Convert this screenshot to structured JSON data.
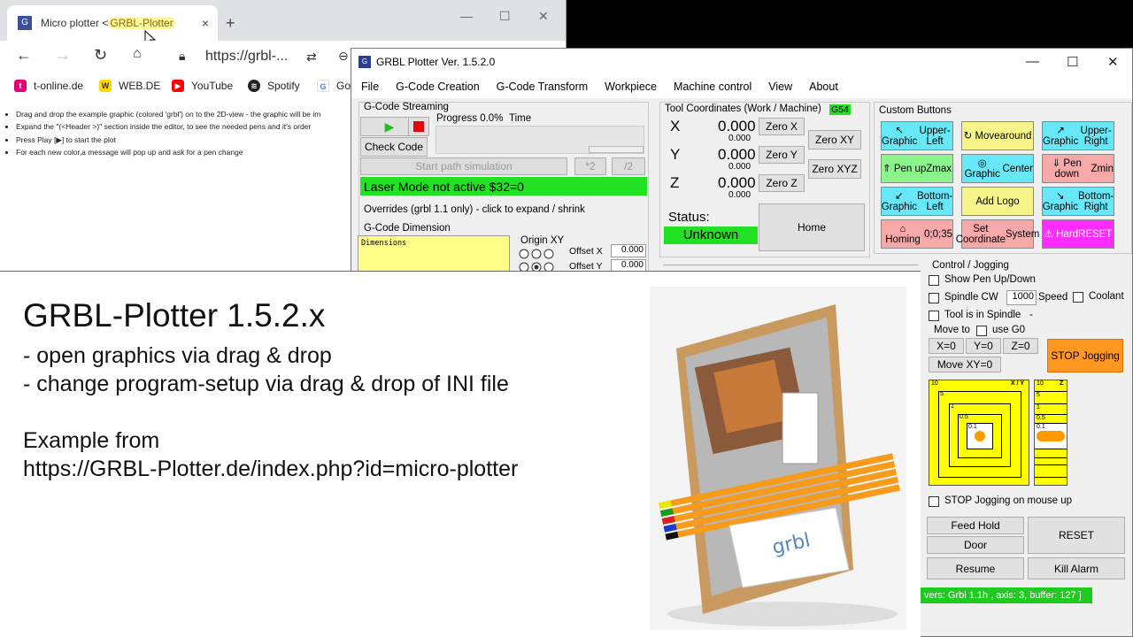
{
  "browser": {
    "tab_title_a": "Micro plotter < ",
    "tab_title_b": "GRBL-Plotter",
    "tab_close": "×",
    "new_tab": "+",
    "win_min": "—",
    "win_max": "☐",
    "win_close": "✕",
    "url": "https://grbl-...",
    "bookmarks": [
      "t-online.de",
      "WEB.DE",
      "YouTube",
      "Spotify",
      "Go"
    ],
    "page_lines": [
      "Drag and drop the example graphic (colored 'grbl') on to the 2D-view - the graphic will be im",
      "Expand the \"(<Header >)\" section inside the editor, to see the needed pens and it's order",
      "Press Play [▶] to start the plot",
      "For each new color,a message will pop up and ask for a pen change"
    ]
  },
  "grbl": {
    "title": "GRBL Plotter Ver. 1.5.2.0",
    "menu": [
      "File",
      "G-Code Creation",
      "G-Code Transform",
      "Workpiece",
      "Machine control",
      "View",
      "About"
    ],
    "streaming": {
      "label": "G-Code Streaming",
      "progress": "Progress 0.0%",
      "time": "Time",
      "check_code": "Check Code",
      "sim": "Start path simulation",
      "x2": "*2",
      "d2": "/2",
      "laser": "Laser Mode not active $32=0",
      "overrides": "Overrides (grbl 1.1 only) - click to expand / shrink",
      "dimension": "G-Code Dimension",
      "dimensions_box": "Dimensions",
      "origin": "Origin XY",
      "offset_x_label": "Offset X",
      "offset_y_label": "Offset Y",
      "offset_x": "0.000",
      "offset_y": "0.000"
    },
    "coords": {
      "label": "Tool Coordinates (Work / Machine)",
      "g54": "G54",
      "x": "X",
      "y": "Y",
      "z": "Z",
      "xw": "0.000",
      "xm": "0.000",
      "yw": "0.000",
      "ym": "0.000",
      "zw": "0.000",
      "zm": "0.000",
      "zero_x": "Zero X",
      "zero_y": "Zero Y",
      "zero_z": "Zero Z",
      "zero_xy": "Zero XY",
      "zero_xyz": "Zero XYZ",
      "status_label": "Status:",
      "status": "Unknown",
      "home": "Home"
    },
    "custom": {
      "label": "Custom Buttons",
      "buttons": [
        {
          "l1": "↖ Graphic",
          "l2": "Upper-Left",
          "color": "#66e8f8"
        },
        {
          "l1": "↻ Move",
          "l2": "around",
          "color": "#f7f58a"
        },
        {
          "l1": "↗ Graphic",
          "l2": "Upper-Right",
          "color": "#66e8f8"
        },
        {
          "l1": "⇑ Pen up",
          "l2": "Zmax",
          "color": "#8bf58b"
        },
        {
          "l1": "◎ Graphic",
          "l2": "Center",
          "color": "#66e8f8"
        },
        {
          "l1": "⇓ Pen down",
          "l2": "Zmin",
          "color": "#f7a8a8"
        },
        {
          "l1": "↙ Graphic",
          "l2": "Bottom-Left",
          "color": "#66e8f8"
        },
        {
          "l1": "Add Logo",
          "l2": "",
          "color": "#f7f58a"
        },
        {
          "l1": "↘ Graphic",
          "l2": "Bottom-Right",
          "color": "#66e8f8"
        },
        {
          "l1": "⌂ Homing",
          "l2": "0;0;35",
          "color": "#f7a8a8"
        },
        {
          "l1": "Set Coordinate",
          "l2": "System",
          "color": "#f7a8a8"
        },
        {
          "l1": "⚠ Hard",
          "l2": "RESET",
          "color": "#ff2cff"
        }
      ]
    },
    "jog": {
      "label": "Control / Jogging",
      "show_pen": "Show Pen Up/Down",
      "spindle": "Spindle CW",
      "speed_val": "1000",
      "speed": "Speed",
      "coolant": "Coolant",
      "tool_in_spindle": "Tool is in Spindle",
      "dash": "-",
      "move_to": "Move to",
      "use_g0": "use G0",
      "x0": "X=0",
      "y0": "Y=0",
      "z0": "Z=0",
      "move_xy0": "Move XY=0",
      "stop_jog": "STOP Jogging",
      "xy_ticks": [
        "10",
        "5",
        "1",
        "0.5",
        "0.1"
      ],
      "xy_corner": "X / Y",
      "z_ticks": [
        "10",
        "5",
        "1",
        "0.5",
        "0.1"
      ],
      "z_corner": "Z",
      "stop_on_mouseup": "STOP Jogging on mouse up",
      "feed_hold": "Feed Hold",
      "door": "Door",
      "resume": "Resume",
      "reset": "RESET",
      "kill_alarm": "Kill Alarm",
      "status_bar": "vers: Grbl 1.1h , axis: 3, buffer: 127 ]"
    }
  },
  "overlay": {
    "title": "GRBL-Plotter 1.5.2.x",
    "bullet1": "- open graphics via drag & drop",
    "bullet2": "- change program-setup via drag & drop of INI file",
    "example": "Example from",
    "url": "https://GRBL-Plotter.de/index.php?id=micro-plotter",
    "photo_text": "grbl"
  },
  "colors": {
    "green": "#22e022",
    "yellow": "#ffff55",
    "orange": "#ff9820"
  }
}
